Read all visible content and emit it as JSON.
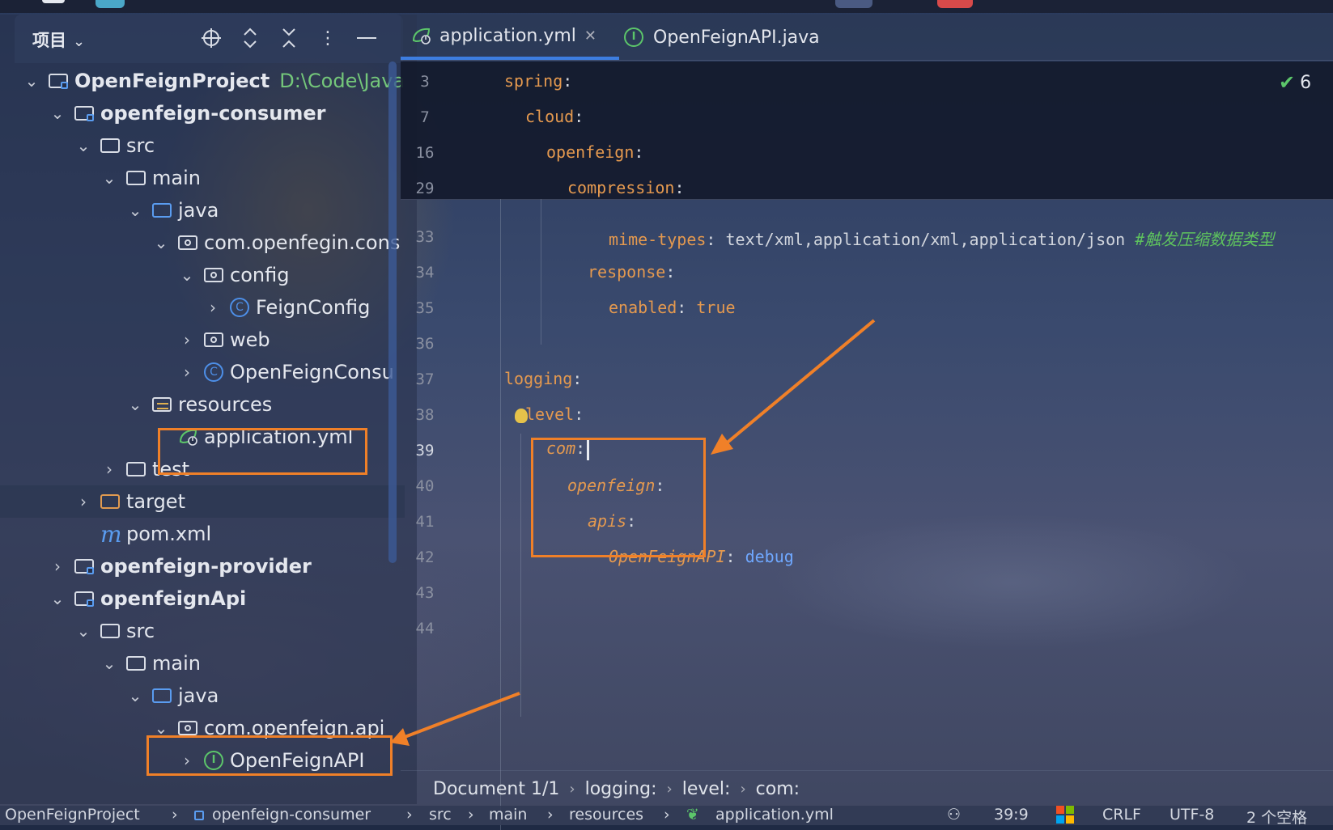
{
  "project_panel": {
    "title": "项目",
    "tree": [
      {
        "label": "OpenFeignProject",
        "path": "D:\\Code\\JavaC"
      },
      {
        "label": "openfeign-consumer"
      },
      {
        "label": "src"
      },
      {
        "label": "main"
      },
      {
        "label": "java"
      },
      {
        "label": "com.openfegin.cons"
      },
      {
        "label": "config"
      },
      {
        "label": "FeignConfig"
      },
      {
        "label": "web"
      },
      {
        "label": "OpenFeignConsu"
      },
      {
        "label": "resources"
      },
      {
        "label": "application.yml"
      },
      {
        "label": "test"
      },
      {
        "label": "target"
      },
      {
        "label": "pom.xml"
      },
      {
        "label": "openfeign-provider"
      },
      {
        "label": "openfeignApi"
      },
      {
        "label": "src"
      },
      {
        "label": "main"
      },
      {
        "label": "java"
      },
      {
        "label": "com.openfeign.api"
      },
      {
        "label": "OpenFeignAPI"
      }
    ]
  },
  "tabs": [
    {
      "label": "application.yml",
      "active": true
    },
    {
      "label": "OpenFeignAPI.java",
      "active": false
    }
  ],
  "inspections": {
    "count": "6"
  },
  "editor": {
    "lines": [
      {
        "num": "3",
        "key": "spring"
      },
      {
        "num": "7",
        "key": "cloud"
      },
      {
        "num": "16",
        "key": "openfeign"
      },
      {
        "num": "29",
        "key": "compression"
      },
      {
        "num": "33",
        "key": "mime-types",
        "value": "text/xml,application/xml,application/json",
        "comment": "#触发压缩数据类型"
      },
      {
        "num": "34",
        "key": "response"
      },
      {
        "num": "35",
        "key": "enabled",
        "value": "true"
      },
      {
        "num": "36"
      },
      {
        "num": "37",
        "key": "logging"
      },
      {
        "num": "38",
        "key": "level"
      },
      {
        "num": "39",
        "key": "com"
      },
      {
        "num": "40",
        "key": "openfeign"
      },
      {
        "num": "41",
        "key": "apis"
      },
      {
        "num": "42",
        "key": "OpenFeignAPI",
        "value": "debug"
      },
      {
        "num": "43"
      },
      {
        "num": "44"
      }
    ]
  },
  "breadcrumb": [
    "Document 1/1",
    "logging:",
    "level:",
    "com:"
  ],
  "statusbar": {
    "path": [
      "OpenFeignProject",
      "openfeign-consumer",
      "src",
      "main",
      "resources",
      "application.yml"
    ],
    "position": "39:9",
    "line_ending": "CRLF",
    "encoding": "UTF-8",
    "indent": "2 个空格"
  },
  "colors": {
    "accent": "#3d7de0",
    "highlight": "#f08028",
    "yaml_key": "#e4994f",
    "comment": "#5ec25e"
  }
}
